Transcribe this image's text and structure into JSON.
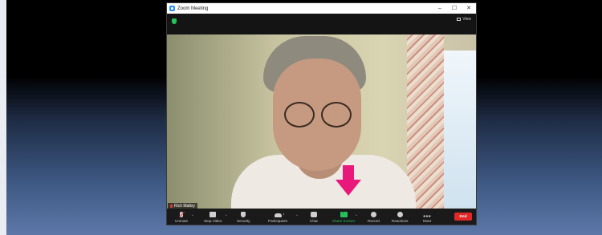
{
  "window": {
    "title": "Zoom Meeting",
    "controls": {
      "minimize": "–",
      "maximize": "☐",
      "close": "✕"
    }
  },
  "topbar": {
    "view_label": "View"
  },
  "video": {
    "participant_name": "Rich Malloy"
  },
  "toolbar": {
    "unmute": "Unmute",
    "stop_video": "Stop Video",
    "security": "Security",
    "participants": "Participants",
    "participants_count": "1",
    "chat": "Chat",
    "share_screen": "Share Screen",
    "record": "Record",
    "reactions": "Reactions",
    "more": "More",
    "end": "End"
  },
  "colors": {
    "share_green": "#24c25b",
    "end_red": "#e02828",
    "arrow_pink": "#e8197b",
    "zoom_blue": "#2d8cff"
  },
  "icons": [
    "zoom-app-icon",
    "security-shield-icon",
    "view-grid-icon",
    "mic-muted-icon",
    "video-camera-icon",
    "security-icon",
    "participants-icon",
    "chat-icon",
    "share-screen-icon",
    "record-icon",
    "reactions-icon",
    "more-icon",
    "pink-arrow-icon"
  ]
}
